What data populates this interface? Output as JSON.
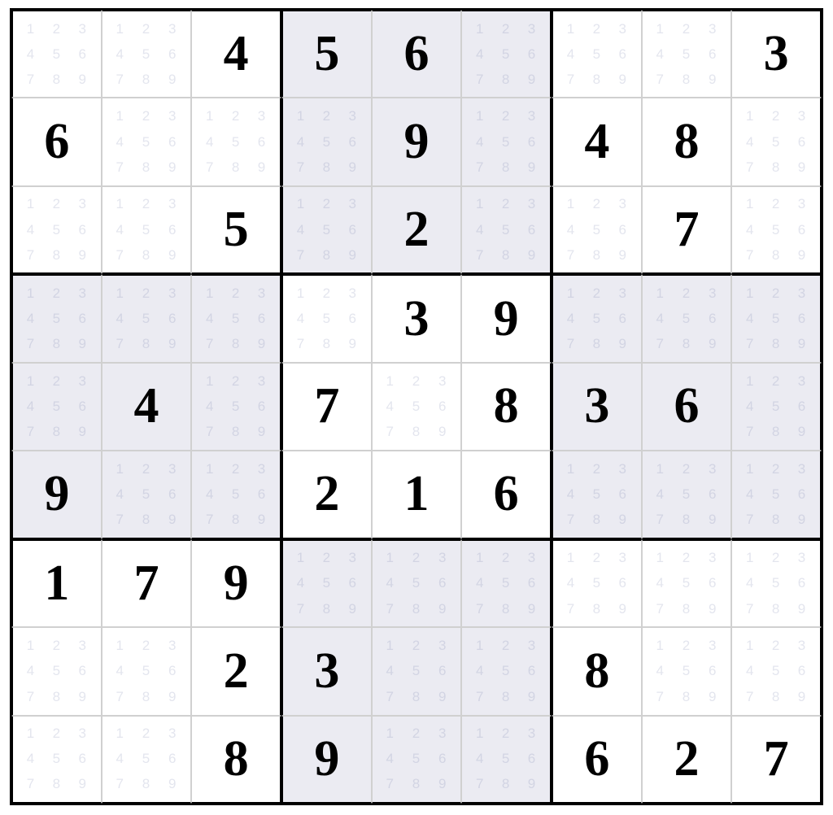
{
  "game": "sudoku",
  "size": 9,
  "pencil_marks": [
    1,
    2,
    3,
    4,
    5,
    6,
    7,
    8,
    9
  ],
  "grid": [
    [
      null,
      null,
      4,
      5,
      6,
      null,
      null,
      null,
      3
    ],
    [
      6,
      null,
      null,
      null,
      9,
      null,
      4,
      8,
      null
    ],
    [
      null,
      null,
      5,
      null,
      2,
      null,
      null,
      7,
      null
    ],
    [
      null,
      null,
      null,
      null,
      3,
      9,
      null,
      null,
      null
    ],
    [
      null,
      4,
      null,
      7,
      null,
      8,
      3,
      6,
      null
    ],
    [
      9,
      null,
      null,
      2,
      1,
      6,
      null,
      null,
      null
    ],
    [
      1,
      7,
      9,
      null,
      null,
      null,
      null,
      null,
      null
    ],
    [
      null,
      null,
      2,
      3,
      null,
      null,
      8,
      null,
      null
    ],
    [
      null,
      null,
      8,
      9,
      null,
      null,
      6,
      2,
      7
    ]
  ],
  "colors": {
    "shade": "#ebebf2",
    "grid_line": "#d0d0d0",
    "box_line": "#000000",
    "pencil": "rgba(100,110,160,0.18)"
  }
}
